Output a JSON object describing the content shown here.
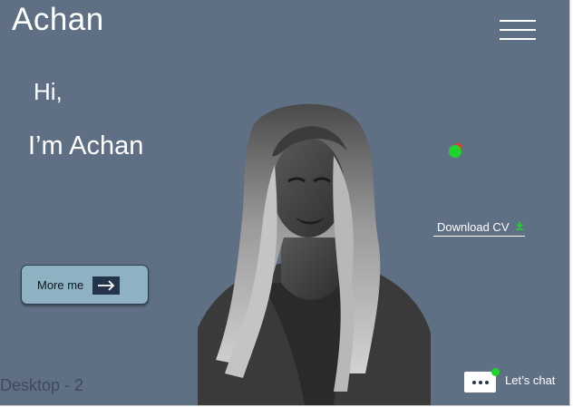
{
  "header": {
    "logo_text": "Achan",
    "menu_icon": "hamburger-menu-icon"
  },
  "hero": {
    "greeting": "Hi,",
    "name_line": "I’m Achan"
  },
  "status": {
    "icon": "online-status-icon",
    "colors": {
      "online": "#1fd42a",
      "alert": "#e23b2e"
    }
  },
  "download": {
    "label": "Download CV",
    "icon": "download-icon",
    "icon_color": "#1fd42a"
  },
  "more_button": {
    "label": "More me",
    "icon": "arrow-right-icon"
  },
  "portrait": {
    "icon": "portrait-photo"
  },
  "frame": {
    "label": "Desktop - 2"
  },
  "chat": {
    "label": "Let’s chat",
    "icon": "chat-dots-icon"
  },
  "colors": {
    "background": "#5f6f84",
    "button": "#8eb2c2",
    "button_dark": "#24344a",
    "text": "#ffffff"
  }
}
